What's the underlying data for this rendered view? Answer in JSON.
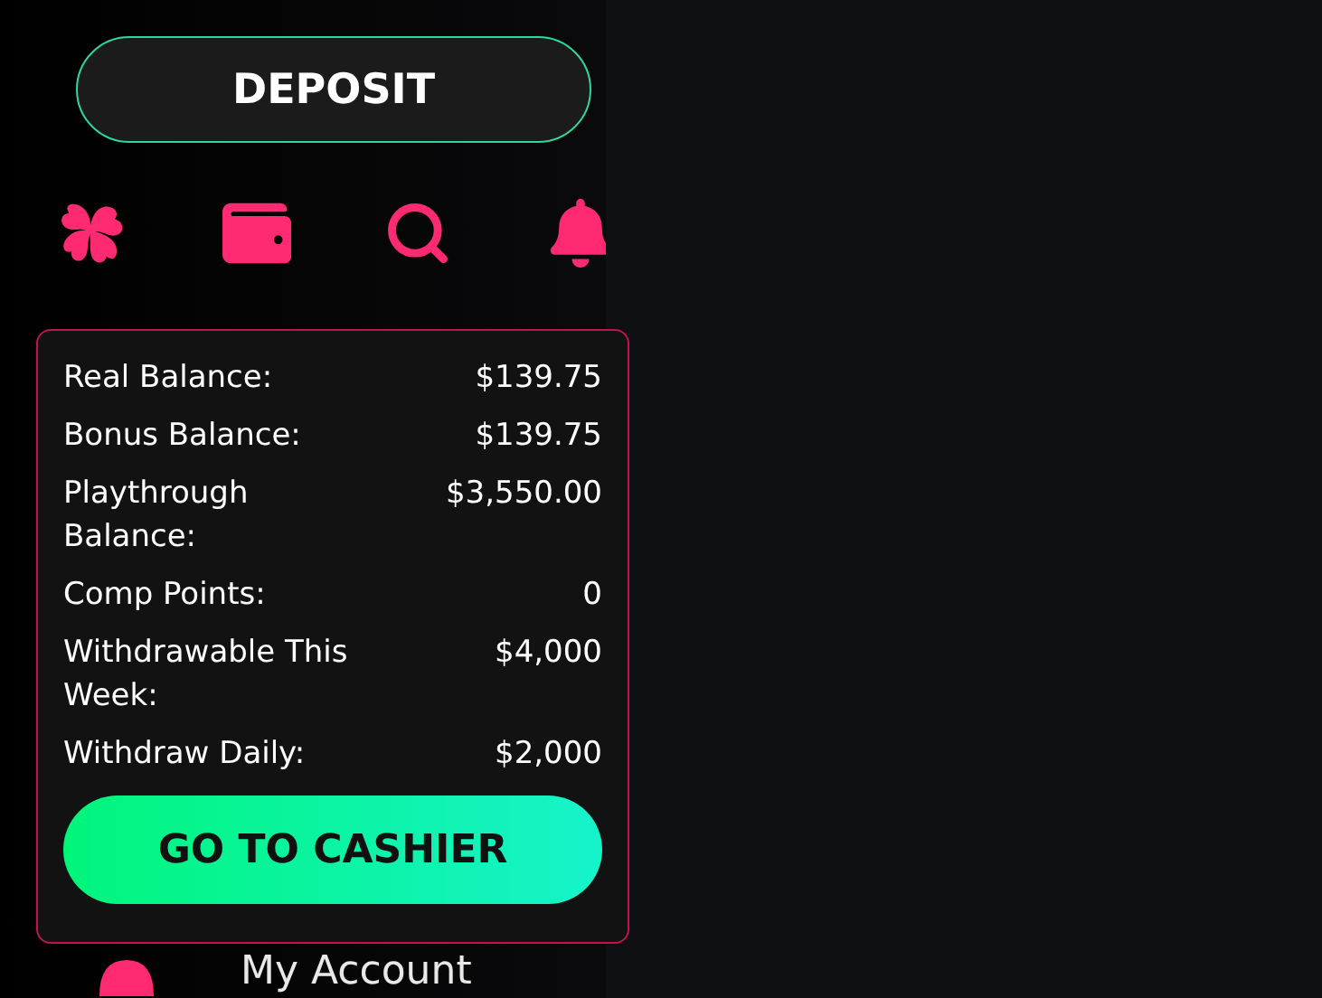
{
  "deposit_button": {
    "label": "DEPOSIT"
  },
  "menu": [
    {
      "label": "My Account"
    }
  ],
  "balance_popup": {
    "rows": [
      {
        "label": "Real Balance:",
        "value": "$139.75"
      },
      {
        "label": "Bonus Balance:",
        "value": "$139.75"
      },
      {
        "label": "Playthrough Balance:",
        "value": "$3,550.00"
      },
      {
        "label": "Comp Points:",
        "value": "0"
      },
      {
        "label": "Withdrawable This Week:",
        "value": "$4,000"
      },
      {
        "label": "Withdraw Daily:",
        "value": "$2,000"
      }
    ],
    "cashier_button": {
      "label": "GO TO CASHIER"
    }
  }
}
